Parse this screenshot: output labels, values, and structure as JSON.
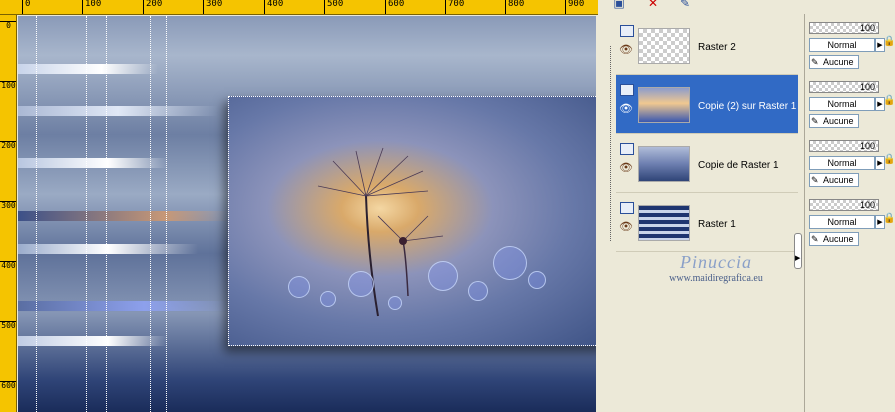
{
  "ruler_top": {
    "labels": [
      "0",
      "100",
      "200",
      "300",
      "400",
      "500",
      "600",
      "700",
      "800",
      "900"
    ]
  },
  "ruler_left": {
    "labels": [
      "0",
      "100",
      "200",
      "300",
      "400",
      "500",
      "600"
    ]
  },
  "toolbar": {
    "icons": [
      "new-layer-icon",
      "delete-layer-icon",
      "brush-icon"
    ]
  },
  "layers": [
    {
      "name": "Raster 2",
      "selected": false
    },
    {
      "name": "Copie (2) sur Raster 1",
      "selected": true
    },
    {
      "name": "Copie de Raster 1",
      "selected": false
    },
    {
      "name": "Raster 1",
      "selected": false
    }
  ],
  "properties": [
    {
      "opacity": "100",
      "blend": "Normal",
      "mask": "Aucune"
    },
    {
      "opacity": "100",
      "blend": "Normal",
      "mask": "Aucune"
    },
    {
      "opacity": "100",
      "blend": "Normal",
      "mask": "Aucune"
    },
    {
      "opacity": "100",
      "blend": "Normal",
      "mask": "Aucune"
    }
  ],
  "watermark": {
    "name": "Pinuccia",
    "url": "www.maidiregrafica.eu"
  }
}
